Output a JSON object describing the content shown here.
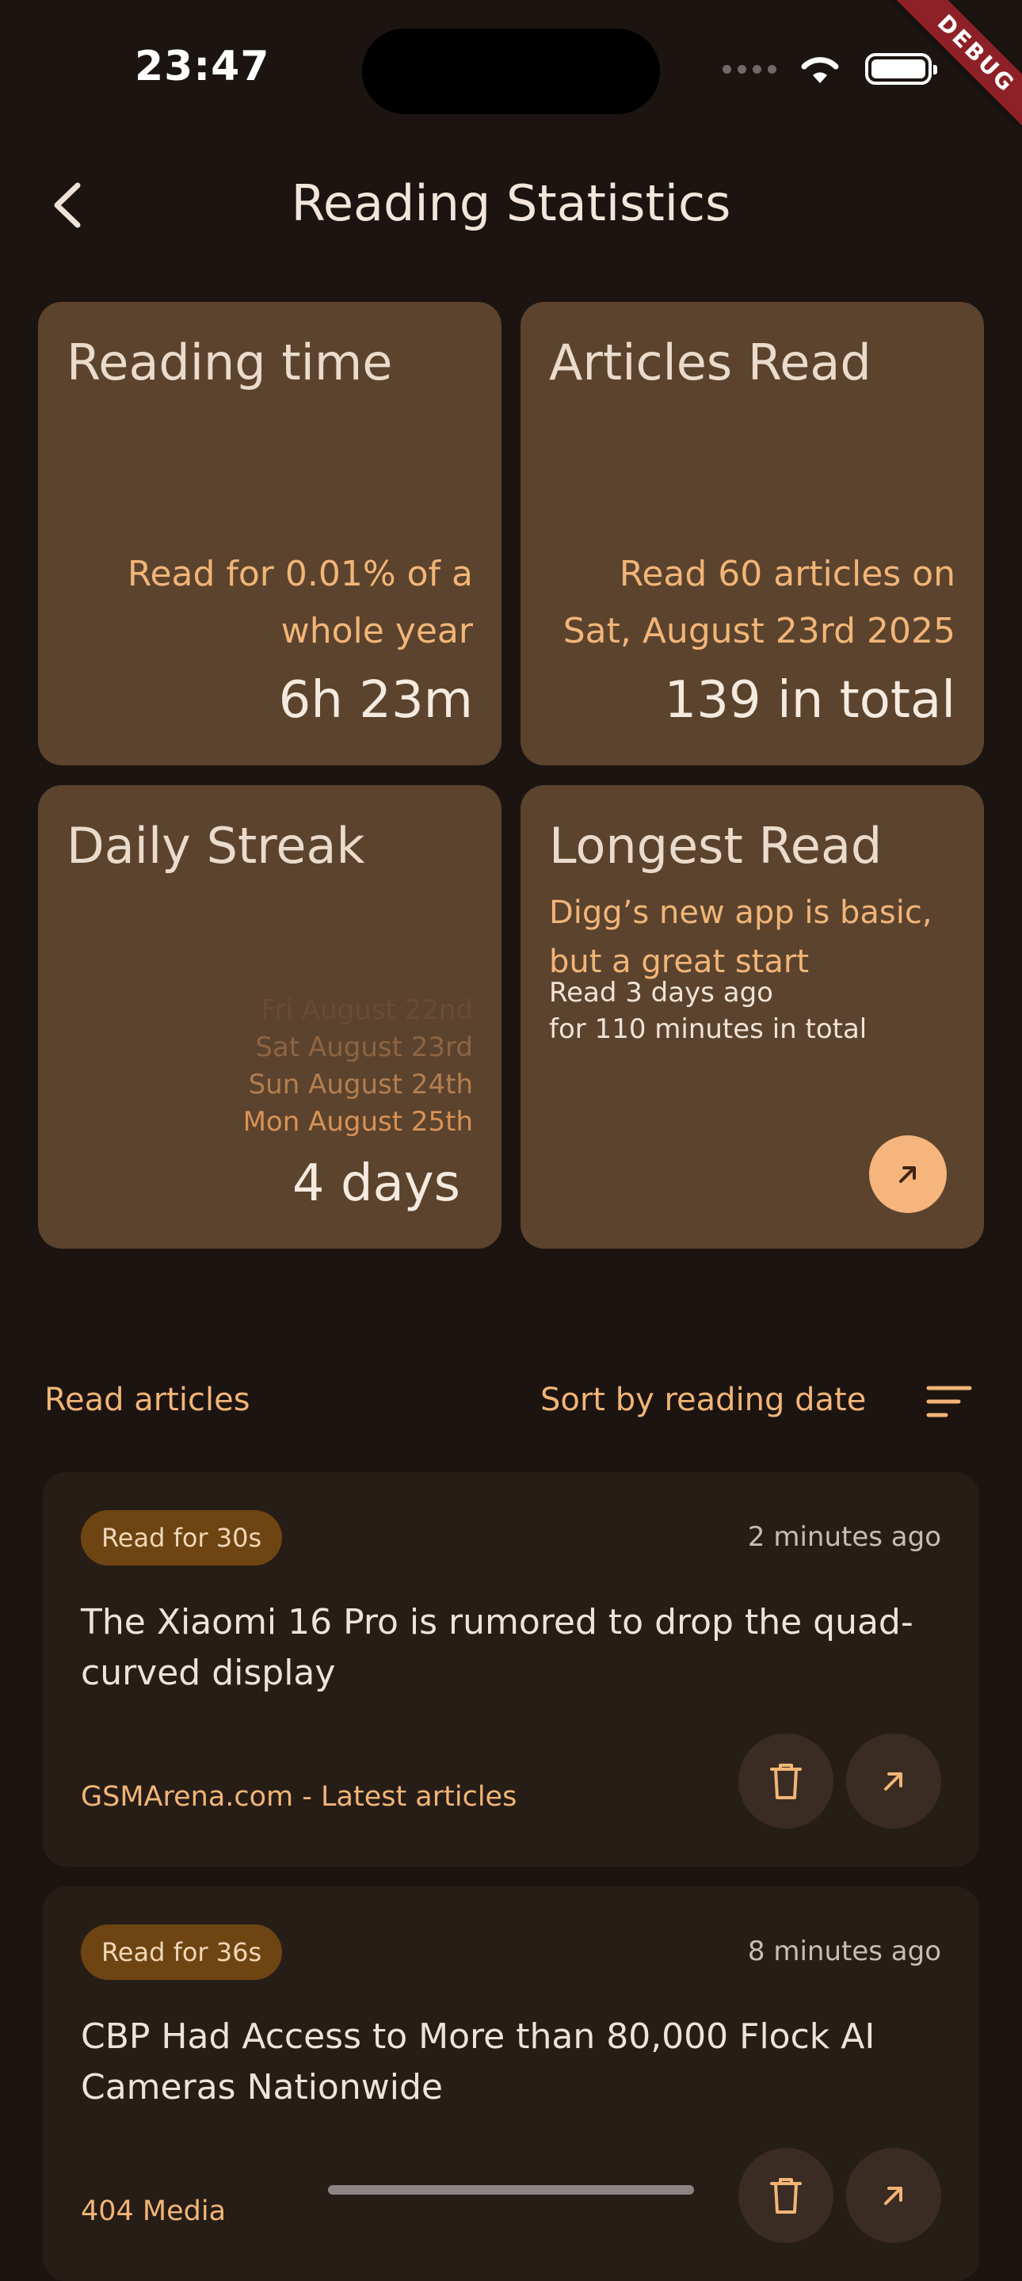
{
  "status_bar": {
    "time": "23:47"
  },
  "debug_banner": "DEBUG",
  "header": {
    "title": "Reading Statistics"
  },
  "cards": {
    "reading_time": {
      "title": "Reading time",
      "subtitle": "Read for 0.01% of a whole year",
      "value": "6h 23m"
    },
    "articles_read": {
      "title": "Articles Read",
      "subtitle": "Read 60 articles on Sat, August 23rd 2025",
      "value": "139 in total"
    },
    "daily_streak": {
      "title": "Daily Streak",
      "days": [
        "Fri August 22nd",
        "Sat August 23rd",
        "Sun August 24th",
        "Mon August 25th"
      ],
      "value": "4 days"
    },
    "longest_read": {
      "title": "Longest Read",
      "article": "Digg’s new app is basic, but a great start",
      "when": "Read 3 days ago",
      "duration": "for 110 minutes in total"
    }
  },
  "list": {
    "label": "Read articles",
    "sort_label": "Sort by reading date",
    "articles": [
      {
        "badge": "Read for 30s",
        "ago": "2 minutes ago",
        "title": "The Xiaomi 16 Pro is rumored to drop the quad-curved display",
        "source": "GSMArena.com - Latest articles"
      },
      {
        "badge": "Read for 36s",
        "ago": "8 minutes ago",
        "title": "CBP Had Access to More than 80,000 Flock AI Cameras Nationwide",
        "source": "404 Media"
      }
    ]
  },
  "colors": {
    "background": "#1c1411",
    "card": "#5b432e",
    "accent": "#f2b577",
    "article_card": "#271d17",
    "badge": "#6e4512"
  }
}
